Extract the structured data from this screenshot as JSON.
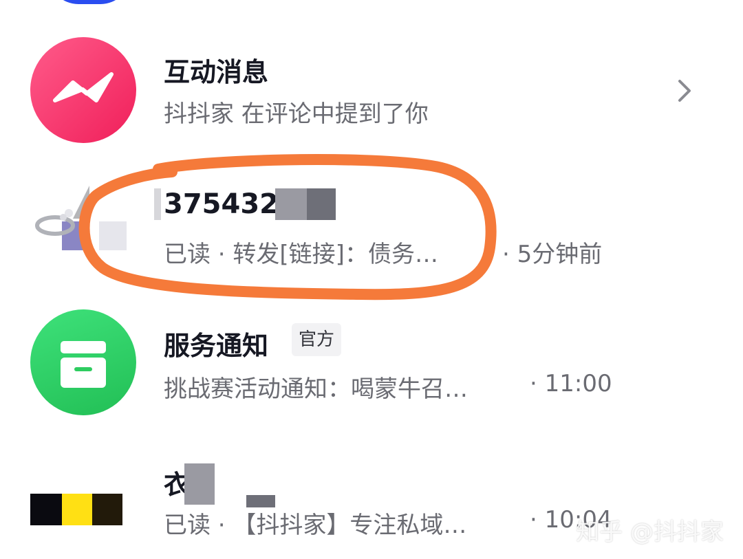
{
  "rows": [
    {
      "title": "互动消息",
      "subtitle": "抖抖家 在评论中提到了你",
      "icon": "chat-wave-icon",
      "color": "#f5276c"
    },
    {
      "title": "3754321",
      "subtitle": "已读 · 转发[链接]：债务…",
      "time": "· 5分钟前",
      "icon": "ring-photo-icon"
    },
    {
      "title": "服务通知",
      "badge": "官方",
      "subtitle": "挑战赛活动通知：喝蒙牛召…",
      "time": "· 11:00",
      "icon": "inbox-box-icon",
      "color": "#2ecc60"
    },
    {
      "title": "衣",
      "subtitle": "已读 · 【抖抖家】专注私域…",
      "time": "· 10:04",
      "icon": "stripe-avatar-icon"
    }
  ],
  "watermark": "知乎 @抖抖家",
  "colors": {
    "annotation": "#f57a3a",
    "accent_blue": "#2a4df0"
  }
}
